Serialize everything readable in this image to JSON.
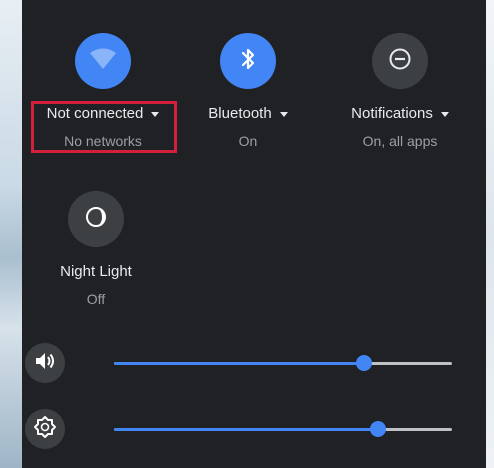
{
  "tiles": {
    "network": {
      "label": "Not connected",
      "status": "No networks",
      "icon": "wifi-icon",
      "active": true
    },
    "bluetooth": {
      "label": "Bluetooth",
      "status": "On",
      "icon": "bluetooth-icon",
      "active": true
    },
    "notifications": {
      "label": "Notifications",
      "status": "On, all apps",
      "icon": "do-not-disturb-icon",
      "active": false
    },
    "night_light": {
      "label": "Night Light",
      "status": "Off",
      "icon": "night-light-icon",
      "active": false
    }
  },
  "sliders": {
    "volume": {
      "icon": "volume-icon",
      "level": 0.74
    },
    "brightness": {
      "icon": "brightness-icon",
      "level": 0.78
    }
  },
  "colors": {
    "accent": "#4285f4",
    "panel": "#202124",
    "highlight": "#d21f3c"
  }
}
